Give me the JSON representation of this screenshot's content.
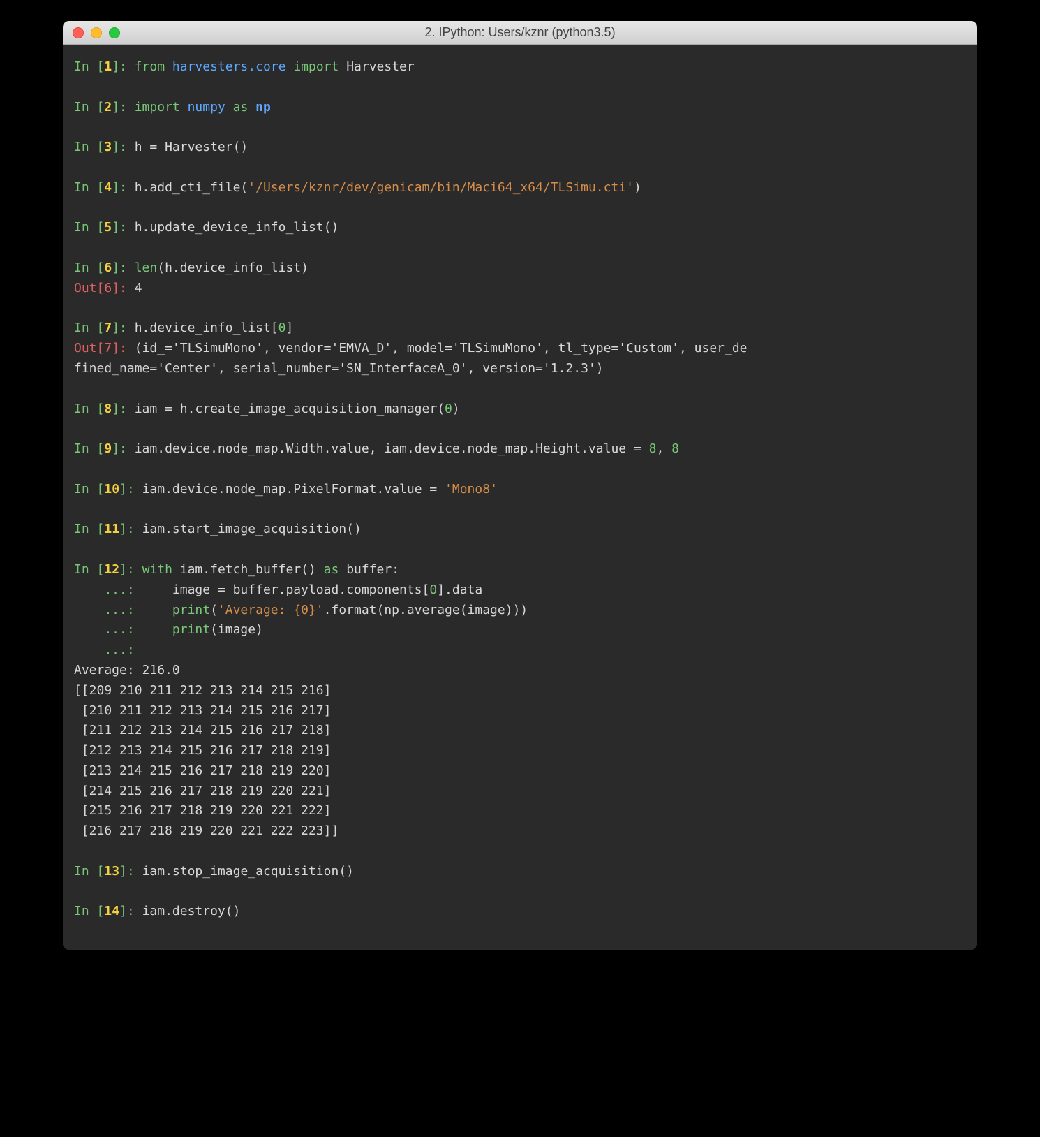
{
  "window": {
    "title": "2. IPython: Users/kznr (python3.5)"
  },
  "prompts": {
    "in": "In ",
    "out": "Out",
    "cont": "   ...: "
  },
  "lines": {
    "1": {
      "n": "1",
      "kw_from": "from",
      "mod": "harvesters.core",
      "kw_import": "import",
      "cls": "Harvester"
    },
    "2": {
      "n": "2",
      "kw_import": "import",
      "mod": "numpy",
      "kw_as": "as",
      "alias": "np"
    },
    "3": {
      "n": "3",
      "code": "h = Harvester()"
    },
    "4": {
      "n": "4",
      "pre": "h.add_cti_file(",
      "str": "'/Users/kznr/dev/genicam/bin/Maci64_x64/TLSimu.cti'",
      "post": ")"
    },
    "5": {
      "n": "5",
      "code": "h.update_device_info_list()"
    },
    "6": {
      "n": "6",
      "fn": "len",
      "args": "(h.device_info_list)",
      "out": "4"
    },
    "7": {
      "n": "7",
      "pre": "h.device_info_list[",
      "idx": "0",
      "post": "]",
      "out": "(id_='TLSimuMono', vendor='EMVA_D', model='TLSimuMono', tl_type='Custom', user_de\nfined_name='Center', serial_number='SN_InterfaceA_0', version='1.2.3')"
    },
    "8": {
      "n": "8",
      "pre": "iam = h.create_image_acquisition_manager(",
      "arg": "0",
      "post": ")"
    },
    "9": {
      "n": "9",
      "pre": "iam.device.node_map.Width.value, iam.device.node_map.Height.value = ",
      "a": "8",
      "sep": ", ",
      "b": "8"
    },
    "10": {
      "n": "10",
      "pre": "iam.device.node_map.PixelFormat.value = ",
      "str": "'Mono8'"
    },
    "11": {
      "n": "11",
      "code": "iam.start_image_acquisition()"
    },
    "12": {
      "n": "12",
      "kw_with": "with",
      "expr1": " iam.fetch_buffer() ",
      "kw_as": "as",
      "expr2": " buffer:",
      "c1a": "    image = buffer.payload.components[",
      "c1idx": "0",
      "c1b": "].data",
      "c2fn": "print",
      "c2a": "(",
      "c2str": "'Average: {0}'",
      "c2b": ".format(np.average(image)))",
      "c3fn": "print",
      "c3arg": "(image)"
    },
    "13": {
      "n": "13",
      "code": "iam.stop_image_acquisition()"
    },
    "14": {
      "n": "14",
      "code": "iam.destroy()"
    }
  },
  "output": {
    "average_label": "Average: ",
    "average_value": "216.0",
    "matrix": "[[209 210 211 212 213 214 215 216]\n [210 211 212 213 214 215 216 217]\n [211 212 213 214 215 216 217 218]\n [212 213 214 215 216 217 218 219]\n [213 214 215 216 217 218 219 220]\n [214 215 216 217 218 219 220 221]\n [215 216 217 218 219 220 221 222]\n [216 217 218 219 220 221 222 223]]"
  }
}
